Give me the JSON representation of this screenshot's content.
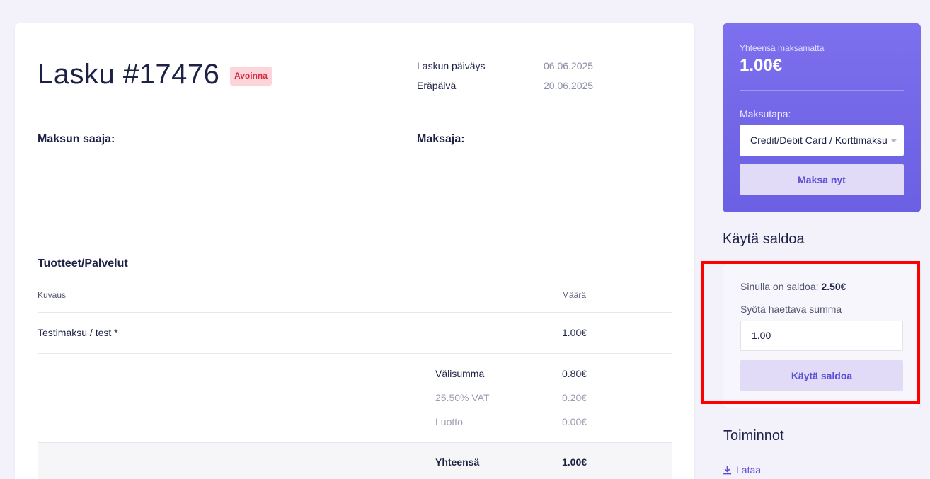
{
  "invoice": {
    "title": "Lasku #17476",
    "status": "Avoinna",
    "meta": [
      {
        "label": "Laskun päiväys",
        "value": "06.06.2025"
      },
      {
        "label": "Eräpäivä",
        "value": "20.06.2025"
      }
    ],
    "recipient_label": "Maksun saaja:",
    "payer_label": "Maksaja:"
  },
  "products": {
    "title": "Tuotteet/Palvelut",
    "col_description": "Kuvaus",
    "col_amount": "Määrä",
    "rows": [
      {
        "description": "Testimaksu / test *",
        "amount": "1.00€"
      }
    ],
    "subtotal_label": "Välisumma",
    "subtotal_value": "0.80€",
    "vat_label": "25.50% VAT",
    "vat_value": "0.20€",
    "credit_label": "Luotto",
    "credit_value": "0.00€",
    "total_label": "Yhteensä",
    "total_value": "1.00€"
  },
  "payment": {
    "unpaid_label": "Yhteensä maksamatta",
    "unpaid_amount": "1.00€",
    "method_label": "Maksutapa:",
    "method_selected": "Credit/Debit Card / Korttimaksu",
    "pay_button": "Maksa nyt"
  },
  "balance": {
    "heading": "Käytä saldoa",
    "balance_prefix": "Sinulla on saldoa: ",
    "balance_amount": "2.50€",
    "amount_label": "Syötä haettava summa",
    "amount_value": "1.00",
    "use_button": "Käytä saldoa"
  },
  "actions": {
    "heading": "Toiminnot",
    "download": "Lataa"
  },
  "colors": {
    "accent": "#6b5fe3",
    "status_bg": "#fbd5da",
    "status_text": "#d6293e",
    "highlight": "#ff0000"
  }
}
